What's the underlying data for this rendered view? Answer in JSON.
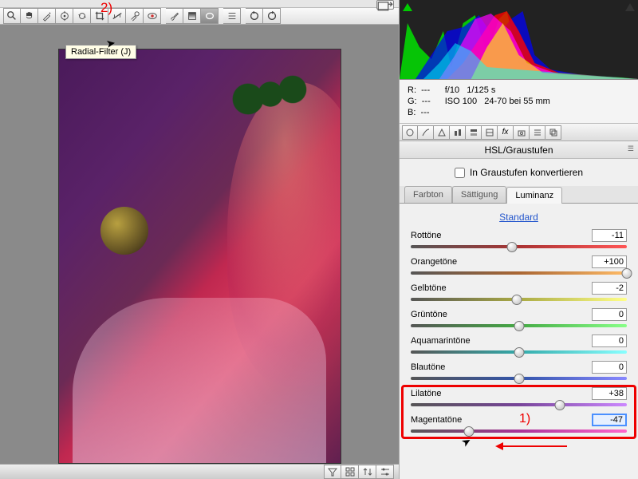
{
  "annotations": {
    "label1": "1)",
    "label2": "2)"
  },
  "toolbar": {
    "tooltip": "Radial-Filter (J)",
    "tools": [
      "zoom",
      "hand",
      "auto",
      "crop",
      "straighten",
      "spot",
      "redeye",
      "adjust",
      "gradient",
      "radial",
      "list",
      "sep",
      "rotate-ccw",
      "rotate-cw"
    ]
  },
  "histogram": {
    "clip_shadow": true,
    "clip_highlight": false
  },
  "info": {
    "r": "R:",
    "g": "G:",
    "b": "B:",
    "dash": "---",
    "aperture": "f/10",
    "shutter": "1/125 s",
    "iso": "ISO 100",
    "lens": "24-70 bei 55 mm"
  },
  "panel": {
    "title": "HSL/Graustufen",
    "convert_label": "In Graustufen konvertieren",
    "convert_checked": false,
    "tabs": {
      "hue": "Farbton",
      "sat": "Sättigung",
      "lum": "Luminanz",
      "active": "lum"
    },
    "default_link": "Standard"
  },
  "sliders": [
    {
      "key": "reds",
      "label": "Rottöne",
      "value": "-11",
      "pos": 0.47,
      "grad": [
        "#555",
        "#a33",
        "#f55"
      ]
    },
    {
      "key": "oranges",
      "label": "Orangetöne",
      "value": "+100",
      "pos": 1.0,
      "grad": [
        "#555",
        "#a63",
        "#fb6"
      ]
    },
    {
      "key": "yellows",
      "label": "Gelbtöne",
      "value": "-2",
      "pos": 0.49,
      "grad": [
        "#555",
        "#aa4",
        "#ff8"
      ]
    },
    {
      "key": "greens",
      "label": "Grüntöne",
      "value": "0",
      "pos": 0.5,
      "grad": [
        "#555",
        "#4a4",
        "#8f8"
      ]
    },
    {
      "key": "aquas",
      "label": "Aquamarintöne",
      "value": "0",
      "pos": 0.5,
      "grad": [
        "#555",
        "#3aa",
        "#8ff"
      ]
    },
    {
      "key": "blues",
      "label": "Blautöne",
      "value": "0",
      "pos": 0.5,
      "grad": [
        "#555",
        "#35a",
        "#88f"
      ]
    },
    {
      "key": "purples",
      "label": "Lilatöne",
      "value": "+38",
      "pos": 0.69,
      "grad": [
        "#555",
        "#749",
        "#c8f"
      ]
    },
    {
      "key": "magentas",
      "label": "Magentatöne",
      "value": "-47",
      "pos": 0.27,
      "grad": [
        "#555",
        "#a39",
        "#f6c"
      ],
      "highlight": true,
      "focused": true
    }
  ]
}
